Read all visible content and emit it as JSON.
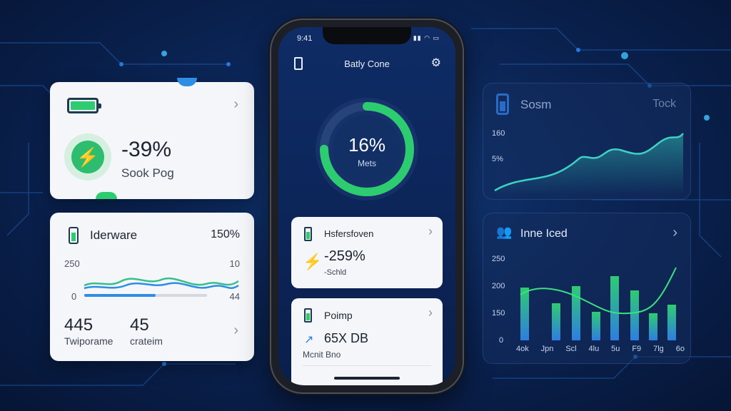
{
  "left_card1": {
    "value": "-39%",
    "label": "Sook Pog"
  },
  "left_card2": {
    "title": "Iderware",
    "percent": "150%",
    "axis_top_left": "250",
    "axis_bottom_left": "0",
    "axis_top_right": "10",
    "axis_bottom_right": "44",
    "stat1_value": "445",
    "stat1_label": "Twiporame",
    "stat2_value": "45",
    "stat2_label": "crateim"
  },
  "phone": {
    "time": "9:41",
    "title": "Batly Cone",
    "ring_value": "16%",
    "ring_label": "Mets",
    "ring_fraction": 0.75,
    "card1": {
      "title": "Hsfersfoven",
      "value": "-259%",
      "sub": "-Schld"
    },
    "card2": {
      "title": "Poimp",
      "value": "65X DB",
      "sub": "Mcnit Bno"
    }
  },
  "right_card1": {
    "title": "Sosm",
    "action": "Tock",
    "y1": "160",
    "y2": "5%"
  },
  "right_card2": {
    "title": "Inne Iced",
    "y_labels": [
      "250",
      "200",
      "150",
      "0"
    ],
    "x_labels": [
      "4ok",
      "Jpn",
      "Scl",
      "4lu",
      "5u",
      "F9",
      "7lg",
      "6o"
    ]
  },
  "colors": {
    "accent_green": "#2ecc71",
    "accent_blue": "#2f7de1",
    "bg": "#0b2556"
  }
}
